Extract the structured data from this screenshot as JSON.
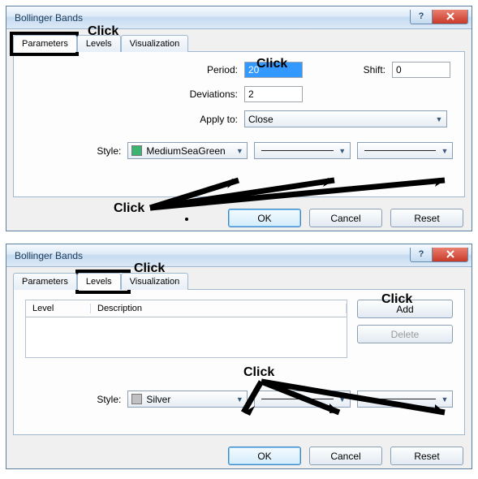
{
  "dialog1": {
    "title": "Bollinger Bands",
    "tabs": {
      "parameters": "Parameters",
      "levels": "Levels",
      "visualization": "Visualization"
    },
    "fields": {
      "period_label": "Period:",
      "period_value": "20",
      "shift_label": "Shift:",
      "shift_value": "0",
      "deviations_label": "Deviations:",
      "deviations_value": "2",
      "applyto_label": "Apply to:",
      "applyto_value": "Close",
      "style_label": "Style:",
      "style_color_name": "MediumSeaGreen",
      "style_color_hex": "#3cb371"
    },
    "buttons": {
      "ok": "OK",
      "cancel": "Cancel",
      "reset": "Reset"
    }
  },
  "dialog2": {
    "title": "Bollinger Bands",
    "tabs": {
      "parameters": "Parameters",
      "levels": "Levels",
      "visualization": "Visualization"
    },
    "list": {
      "col_level": "Level",
      "col_desc": "Description"
    },
    "buttons": {
      "add": "Add",
      "delete": "Delete"
    },
    "style_label": "Style:",
    "style_color_name": "Silver",
    "style_color_hex": "#c0c0c0",
    "footer": {
      "ok": "OK",
      "cancel": "Cancel",
      "reset": "Reset"
    }
  },
  "annotations": {
    "click": "Click"
  }
}
